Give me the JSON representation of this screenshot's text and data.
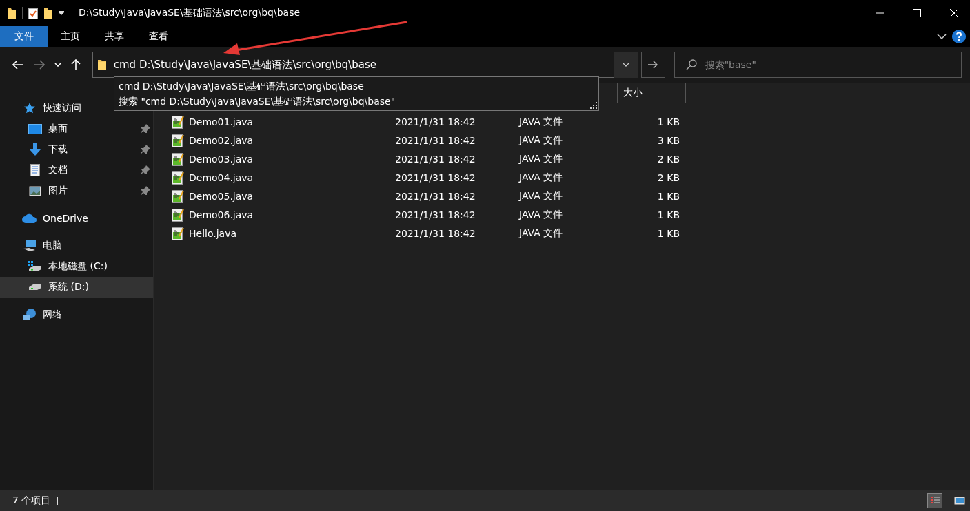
{
  "window": {
    "title": "D:\\Study\\Java\\JavaSE\\基础语法\\src\\org\\bq\\base"
  },
  "ribbon_tabs": [
    {
      "label": "文件",
      "selected": true
    },
    {
      "label": "主页",
      "selected": false
    },
    {
      "label": "共享",
      "selected": false
    },
    {
      "label": "查看",
      "selected": false
    }
  ],
  "address_bar": {
    "value": "cmd D:\\Study\\Java\\JavaSE\\基础语法\\src\\org\\bq\\base"
  },
  "suggestions": [
    "cmd D:\\Study\\Java\\JavaSE\\基础语法\\src\\org\\bq\\base",
    "搜索 \"cmd D:\\Study\\Java\\JavaSE\\基础语法\\src\\org\\bq\\base\""
  ],
  "search": {
    "placeholder": "搜索\"base\""
  },
  "sidebar": {
    "items": [
      {
        "label": "快速访问",
        "kind": "star",
        "selected": false,
        "pinned": false,
        "children": [
          {
            "label": "桌面",
            "kind": "desktop",
            "selected": false,
            "pinned": true
          },
          {
            "label": "下载",
            "kind": "download",
            "selected": false,
            "pinned": true
          },
          {
            "label": "文档",
            "kind": "document",
            "selected": false,
            "pinned": true
          },
          {
            "label": "图片",
            "kind": "pictures",
            "selected": false,
            "pinned": true
          }
        ]
      },
      {
        "label": "OneDrive",
        "kind": "cloud",
        "selected": false,
        "pinned": false
      },
      {
        "label": "电脑",
        "kind": "computer",
        "selected": false,
        "pinned": false,
        "children": [
          {
            "label": "本地磁盘 (C:)",
            "kind": "system-drive",
            "selected": false,
            "pinned": false
          },
          {
            "label": "系统 (D:)",
            "kind": "drive",
            "selected": true,
            "pinned": false
          }
        ]
      },
      {
        "label": "网络",
        "kind": "network",
        "selected": false,
        "pinned": false
      }
    ]
  },
  "table": {
    "columns": [
      {
        "label": "大小"
      }
    ],
    "rows": [
      {
        "name": "Demo01.java",
        "modified": "2021/1/31 18:42",
        "type": "JAVA 文件",
        "size": "1 KB"
      },
      {
        "name": "Demo02.java",
        "modified": "2021/1/31 18:42",
        "type": "JAVA 文件",
        "size": "3 KB"
      },
      {
        "name": "Demo03.java",
        "modified": "2021/1/31 18:42",
        "type": "JAVA 文件",
        "size": "2 KB"
      },
      {
        "name": "Demo04.java",
        "modified": "2021/1/31 18:42",
        "type": "JAVA 文件",
        "size": "2 KB"
      },
      {
        "name": "Demo05.java",
        "modified": "2021/1/31 18:42",
        "type": "JAVA 文件",
        "size": "1 KB"
      },
      {
        "name": "Demo06.java",
        "modified": "2021/1/31 18:42",
        "type": "JAVA 文件",
        "size": "1 KB"
      },
      {
        "name": "Hello.java",
        "modified": "2021/1/31 18:42",
        "type": "JAVA 文件",
        "size": "1 KB"
      }
    ]
  },
  "status_bar": {
    "item_count": "7 个项目"
  },
  "view_buttons": [
    {
      "kind": "details",
      "selected": true
    },
    {
      "kind": "large-icons",
      "selected": false
    }
  ]
}
